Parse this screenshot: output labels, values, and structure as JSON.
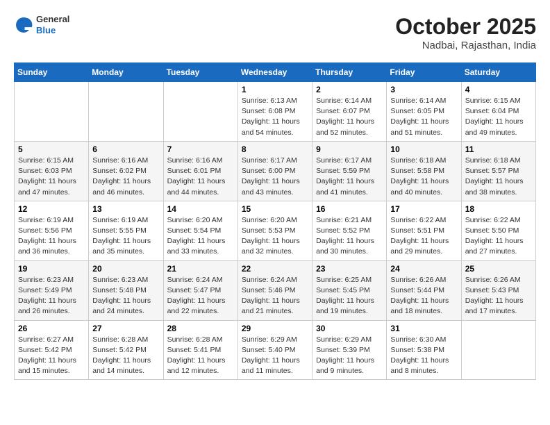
{
  "header": {
    "logo": {
      "line1": "General",
      "line2": "Blue"
    },
    "title": "October 2025",
    "subtitle": "Nadbai, Rajasthan, India"
  },
  "weekdays": [
    "Sunday",
    "Monday",
    "Tuesday",
    "Wednesday",
    "Thursday",
    "Friday",
    "Saturday"
  ],
  "weeks": [
    [
      {
        "day": "",
        "info": ""
      },
      {
        "day": "",
        "info": ""
      },
      {
        "day": "",
        "info": ""
      },
      {
        "day": "1",
        "info": "Sunrise: 6:13 AM\nSunset: 6:08 PM\nDaylight: 11 hours\nand 54 minutes."
      },
      {
        "day": "2",
        "info": "Sunrise: 6:14 AM\nSunset: 6:07 PM\nDaylight: 11 hours\nand 52 minutes."
      },
      {
        "day": "3",
        "info": "Sunrise: 6:14 AM\nSunset: 6:05 PM\nDaylight: 11 hours\nand 51 minutes."
      },
      {
        "day": "4",
        "info": "Sunrise: 6:15 AM\nSunset: 6:04 PM\nDaylight: 11 hours\nand 49 minutes."
      }
    ],
    [
      {
        "day": "5",
        "info": "Sunrise: 6:15 AM\nSunset: 6:03 PM\nDaylight: 11 hours\nand 47 minutes."
      },
      {
        "day": "6",
        "info": "Sunrise: 6:16 AM\nSunset: 6:02 PM\nDaylight: 11 hours\nand 46 minutes."
      },
      {
        "day": "7",
        "info": "Sunrise: 6:16 AM\nSunset: 6:01 PM\nDaylight: 11 hours\nand 44 minutes."
      },
      {
        "day": "8",
        "info": "Sunrise: 6:17 AM\nSunset: 6:00 PM\nDaylight: 11 hours\nand 43 minutes."
      },
      {
        "day": "9",
        "info": "Sunrise: 6:17 AM\nSunset: 5:59 PM\nDaylight: 11 hours\nand 41 minutes."
      },
      {
        "day": "10",
        "info": "Sunrise: 6:18 AM\nSunset: 5:58 PM\nDaylight: 11 hours\nand 40 minutes."
      },
      {
        "day": "11",
        "info": "Sunrise: 6:18 AM\nSunset: 5:57 PM\nDaylight: 11 hours\nand 38 minutes."
      }
    ],
    [
      {
        "day": "12",
        "info": "Sunrise: 6:19 AM\nSunset: 5:56 PM\nDaylight: 11 hours\nand 36 minutes."
      },
      {
        "day": "13",
        "info": "Sunrise: 6:19 AM\nSunset: 5:55 PM\nDaylight: 11 hours\nand 35 minutes."
      },
      {
        "day": "14",
        "info": "Sunrise: 6:20 AM\nSunset: 5:54 PM\nDaylight: 11 hours\nand 33 minutes."
      },
      {
        "day": "15",
        "info": "Sunrise: 6:20 AM\nSunset: 5:53 PM\nDaylight: 11 hours\nand 32 minutes."
      },
      {
        "day": "16",
        "info": "Sunrise: 6:21 AM\nSunset: 5:52 PM\nDaylight: 11 hours\nand 30 minutes."
      },
      {
        "day": "17",
        "info": "Sunrise: 6:22 AM\nSunset: 5:51 PM\nDaylight: 11 hours\nand 29 minutes."
      },
      {
        "day": "18",
        "info": "Sunrise: 6:22 AM\nSunset: 5:50 PM\nDaylight: 11 hours\nand 27 minutes."
      }
    ],
    [
      {
        "day": "19",
        "info": "Sunrise: 6:23 AM\nSunset: 5:49 PM\nDaylight: 11 hours\nand 26 minutes."
      },
      {
        "day": "20",
        "info": "Sunrise: 6:23 AM\nSunset: 5:48 PM\nDaylight: 11 hours\nand 24 minutes."
      },
      {
        "day": "21",
        "info": "Sunrise: 6:24 AM\nSunset: 5:47 PM\nDaylight: 11 hours\nand 22 minutes."
      },
      {
        "day": "22",
        "info": "Sunrise: 6:24 AM\nSunset: 5:46 PM\nDaylight: 11 hours\nand 21 minutes."
      },
      {
        "day": "23",
        "info": "Sunrise: 6:25 AM\nSunset: 5:45 PM\nDaylight: 11 hours\nand 19 minutes."
      },
      {
        "day": "24",
        "info": "Sunrise: 6:26 AM\nSunset: 5:44 PM\nDaylight: 11 hours\nand 18 minutes."
      },
      {
        "day": "25",
        "info": "Sunrise: 6:26 AM\nSunset: 5:43 PM\nDaylight: 11 hours\nand 17 minutes."
      }
    ],
    [
      {
        "day": "26",
        "info": "Sunrise: 6:27 AM\nSunset: 5:42 PM\nDaylight: 11 hours\nand 15 minutes."
      },
      {
        "day": "27",
        "info": "Sunrise: 6:28 AM\nSunset: 5:42 PM\nDaylight: 11 hours\nand 14 minutes."
      },
      {
        "day": "28",
        "info": "Sunrise: 6:28 AM\nSunset: 5:41 PM\nDaylight: 11 hours\nand 12 minutes."
      },
      {
        "day": "29",
        "info": "Sunrise: 6:29 AM\nSunset: 5:40 PM\nDaylight: 11 hours\nand 11 minutes."
      },
      {
        "day": "30",
        "info": "Sunrise: 6:29 AM\nSunset: 5:39 PM\nDaylight: 11 hours\nand 9 minutes."
      },
      {
        "day": "31",
        "info": "Sunrise: 6:30 AM\nSunset: 5:38 PM\nDaylight: 11 hours\nand 8 minutes."
      },
      {
        "day": "",
        "info": ""
      }
    ]
  ]
}
